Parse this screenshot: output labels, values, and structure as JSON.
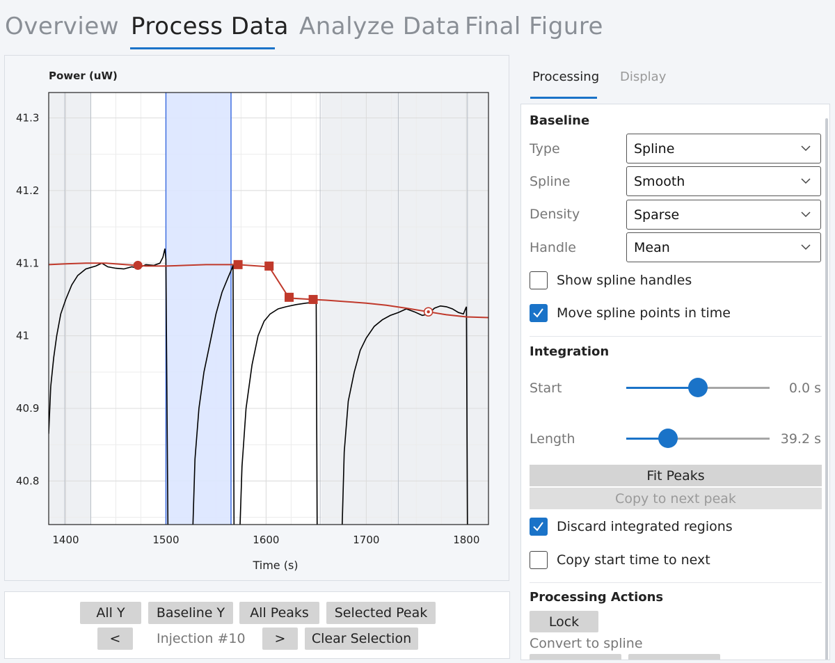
{
  "top_tabs": [
    {
      "label": "Overview",
      "active": false
    },
    {
      "label": "Process Data",
      "active": true
    },
    {
      "label": "Analyze Data",
      "active": false
    },
    {
      "label": "Final Figure",
      "active": false
    }
  ],
  "chart_data": {
    "type": "line",
    "ylabel": "Power (uW)",
    "xlabel": "Time (s)",
    "xlim": [
      1383,
      1822
    ],
    "ylim": [
      40.74,
      41.335
    ],
    "x_ticks": [
      1400,
      1500,
      1600,
      1700,
      1800
    ],
    "y_ticks": [
      40.8,
      40.9,
      41,
      41.1,
      41.2,
      41.3
    ],
    "y_tick_labels": [
      "40.8",
      "40.9",
      "41",
      "41.1",
      "41.2",
      "41.3"
    ],
    "grid": true,
    "shaded_regions": [
      [
        1383,
        1425
      ],
      [
        1655,
        1822
      ]
    ],
    "region_lines": [
      1399,
      1425,
      1654,
      1732,
      1801
    ],
    "selected_region": [
      1500,
      1565
    ],
    "series": [
      {
        "color": "#000000",
        "points": [
          [
            1383,
            40.865
          ],
          [
            1385,
            40.93
          ],
          [
            1388,
            40.97
          ],
          [
            1391,
            41.0
          ],
          [
            1395,
            41.03
          ],
          [
            1400,
            41.05
          ],
          [
            1406,
            41.07
          ],
          [
            1412,
            41.083
          ],
          [
            1420,
            41.092
          ],
          [
            1430,
            41.096
          ],
          [
            1436,
            41.1
          ],
          [
            1442,
            41.095
          ],
          [
            1450,
            41.093
          ],
          [
            1458,
            41.092
          ],
          [
            1466,
            41.095
          ],
          [
            1472,
            41.093
          ],
          [
            1480,
            41.098
          ],
          [
            1488,
            41.097
          ],
          [
            1494,
            41.1
          ],
          [
            1497,
            41.108
          ],
          [
            1499,
            41.12
          ],
          [
            1500,
            41.105
          ],
          [
            1502,
            40.74
          ]
        ]
      },
      {
        "color": "#000000",
        "points": [
          [
            1527,
            40.74
          ],
          [
            1529,
            40.83
          ],
          [
            1533,
            40.9
          ],
          [
            1538,
            40.95
          ],
          [
            1544,
            40.99
          ],
          [
            1550,
            41.03
          ],
          [
            1556,
            41.06
          ],
          [
            1562,
            41.08
          ],
          [
            1566,
            41.093
          ],
          [
            1567,
            41.098
          ],
          [
            1568,
            40.74
          ]
        ]
      },
      {
        "color": "#000000",
        "points": [
          [
            1574,
            40.74
          ],
          [
            1576,
            40.82
          ],
          [
            1580,
            40.9
          ],
          [
            1586,
            40.96
          ],
          [
            1592,
            41.0
          ],
          [
            1598,
            41.02
          ],
          [
            1604,
            41.03
          ],
          [
            1612,
            41.037
          ],
          [
            1620,
            41.04
          ],
          [
            1630,
            41.043
          ],
          [
            1640,
            41.045
          ],
          [
            1648,
            41.046
          ],
          [
            1650,
            41.05
          ],
          [
            1651,
            40.74
          ]
        ]
      },
      {
        "color": "#000000",
        "points": [
          [
            1676,
            40.74
          ],
          [
            1678,
            40.84
          ],
          [
            1682,
            40.91
          ],
          [
            1688,
            40.95
          ],
          [
            1694,
            40.98
          ],
          [
            1700,
            40.997
          ],
          [
            1708,
            41.013
          ],
          [
            1716,
            41.022
          ],
          [
            1724,
            41.028
          ],
          [
            1732,
            41.032
          ],
          [
            1740,
            41.037
          ],
          [
            1748,
            41.033
          ],
          [
            1756,
            41.028
          ],
          [
            1762,
            41.03
          ],
          [
            1768,
            41.038
          ],
          [
            1774,
            41.041
          ],
          [
            1780,
            41.04
          ],
          [
            1786,
            41.037
          ],
          [
            1792,
            41.032
          ],
          [
            1797,
            41.03
          ],
          [
            1799,
            41.037
          ],
          [
            1800,
            41.04
          ],
          [
            1801,
            40.74
          ]
        ]
      },
      {
        "color": "#c0392b",
        "points": [
          [
            1383,
            41.098
          ],
          [
            1400,
            41.099
          ],
          [
            1420,
            41.1
          ],
          [
            1440,
            41.1
          ],
          [
            1460,
            41.098
          ],
          [
            1480,
            41.096
          ],
          [
            1500,
            41.096
          ],
          [
            1520,
            41.097
          ],
          [
            1540,
            41.098
          ],
          [
            1560,
            41.098
          ],
          [
            1572,
            41.098
          ],
          [
            1603,
            41.095
          ],
          [
            1623,
            41.052
          ],
          [
            1647,
            41.05
          ],
          [
            1660,
            41.049
          ],
          [
            1680,
            41.047
          ],
          [
            1700,
            41.045
          ],
          [
            1720,
            41.042
          ],
          [
            1740,
            41.038
          ],
          [
            1762,
            41.033
          ],
          [
            1780,
            41.029
          ],
          [
            1800,
            41.026
          ],
          [
            1822,
            41.025
          ]
        ]
      }
    ],
    "markers": [
      {
        "x": 1472,
        "y": 41.097,
        "shape": "circle"
      },
      {
        "x": 1572,
        "y": 41.098,
        "shape": "square"
      },
      {
        "x": 1603,
        "y": 41.096,
        "shape": "square"
      },
      {
        "x": 1623,
        "y": 41.053,
        "shape": "square"
      },
      {
        "x": 1647,
        "y": 41.05,
        "shape": "square"
      },
      {
        "x": 1762,
        "y": 41.033,
        "shape": "target"
      }
    ]
  },
  "plot_controls": {
    "all_y": "All Y",
    "baseline_y": "Baseline Y",
    "all_peaks": "All Peaks",
    "selected_peak": "Selected Peak",
    "prev": "<",
    "injection_label": "Injection #10",
    "next": ">",
    "clear_selection": "Clear Selection"
  },
  "side_tabs": {
    "processing": "Processing",
    "display": "Display"
  },
  "baseline": {
    "title": "Baseline",
    "type_label": "Type",
    "type_value": "Spline",
    "spline_label": "Spline",
    "spline_value": "Smooth",
    "density_label": "Density",
    "density_value": "Sparse",
    "handle_label": "Handle",
    "handle_value": "Mean",
    "show_handles_label": "Show spline handles",
    "show_handles_checked": false,
    "move_points_label": "Move spline points in time",
    "move_points_checked": true
  },
  "integration": {
    "title": "Integration",
    "start_label": "Start",
    "start_value": "0.0 s",
    "start_fraction": 0.5,
    "length_label": "Length",
    "length_value": "39.2 s",
    "length_fraction": 0.29,
    "fit_peaks": "Fit Peaks",
    "copy_next": "Copy to next peak",
    "discard_label": "Discard integrated regions",
    "discard_checked": true,
    "copy_start_label": "Copy start time to next",
    "copy_start_checked": false
  },
  "actions": {
    "title": "Processing Actions",
    "lock": "Lock",
    "convert_label": "Convert to spline"
  },
  "colors": {
    "accent": "#1a73c8",
    "baseline_red": "#c0392b",
    "selection_fill": "#dbe6ff",
    "selection_line": "#3f6fe0"
  }
}
